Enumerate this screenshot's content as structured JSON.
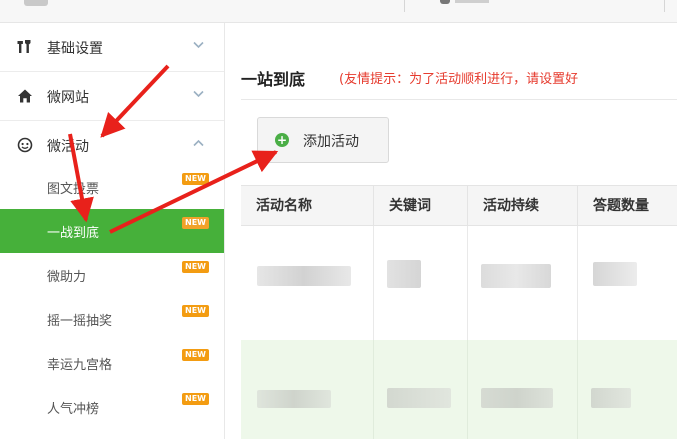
{
  "sidebar": {
    "menus": [
      {
        "label": "基础设置",
        "icon": "tools-icon",
        "expanded": false
      },
      {
        "label": "微网站",
        "icon": "home-icon",
        "expanded": false
      },
      {
        "label": "微活动",
        "icon": "face-icon",
        "expanded": true
      }
    ],
    "submenu": [
      {
        "label": "图文投票",
        "badge": "NEW",
        "active": false
      },
      {
        "label": "一战到底",
        "badge": "NEW",
        "active": true
      },
      {
        "label": "微助力",
        "badge": "NEW",
        "active": false
      },
      {
        "label": "摇一摇抽奖",
        "badge": "NEW",
        "active": false
      },
      {
        "label": "幸运九宫格",
        "badge": "NEW",
        "active": false
      },
      {
        "label": "人气冲榜",
        "badge": "NEW",
        "active": false
      }
    ]
  },
  "main": {
    "title": "一站到底",
    "tip": "(友情提示：为了活动顺利进行，请设置好",
    "add_button": "添加活动",
    "table": {
      "headers": [
        "活动名称",
        "关键词",
        "活动持续",
        "答题数量"
      ]
    }
  },
  "colors": {
    "active_green": "#46b03a",
    "tip_red": "#e63b2e",
    "badge_orange": "#f39c12",
    "annotation_red": "#e8211b"
  }
}
